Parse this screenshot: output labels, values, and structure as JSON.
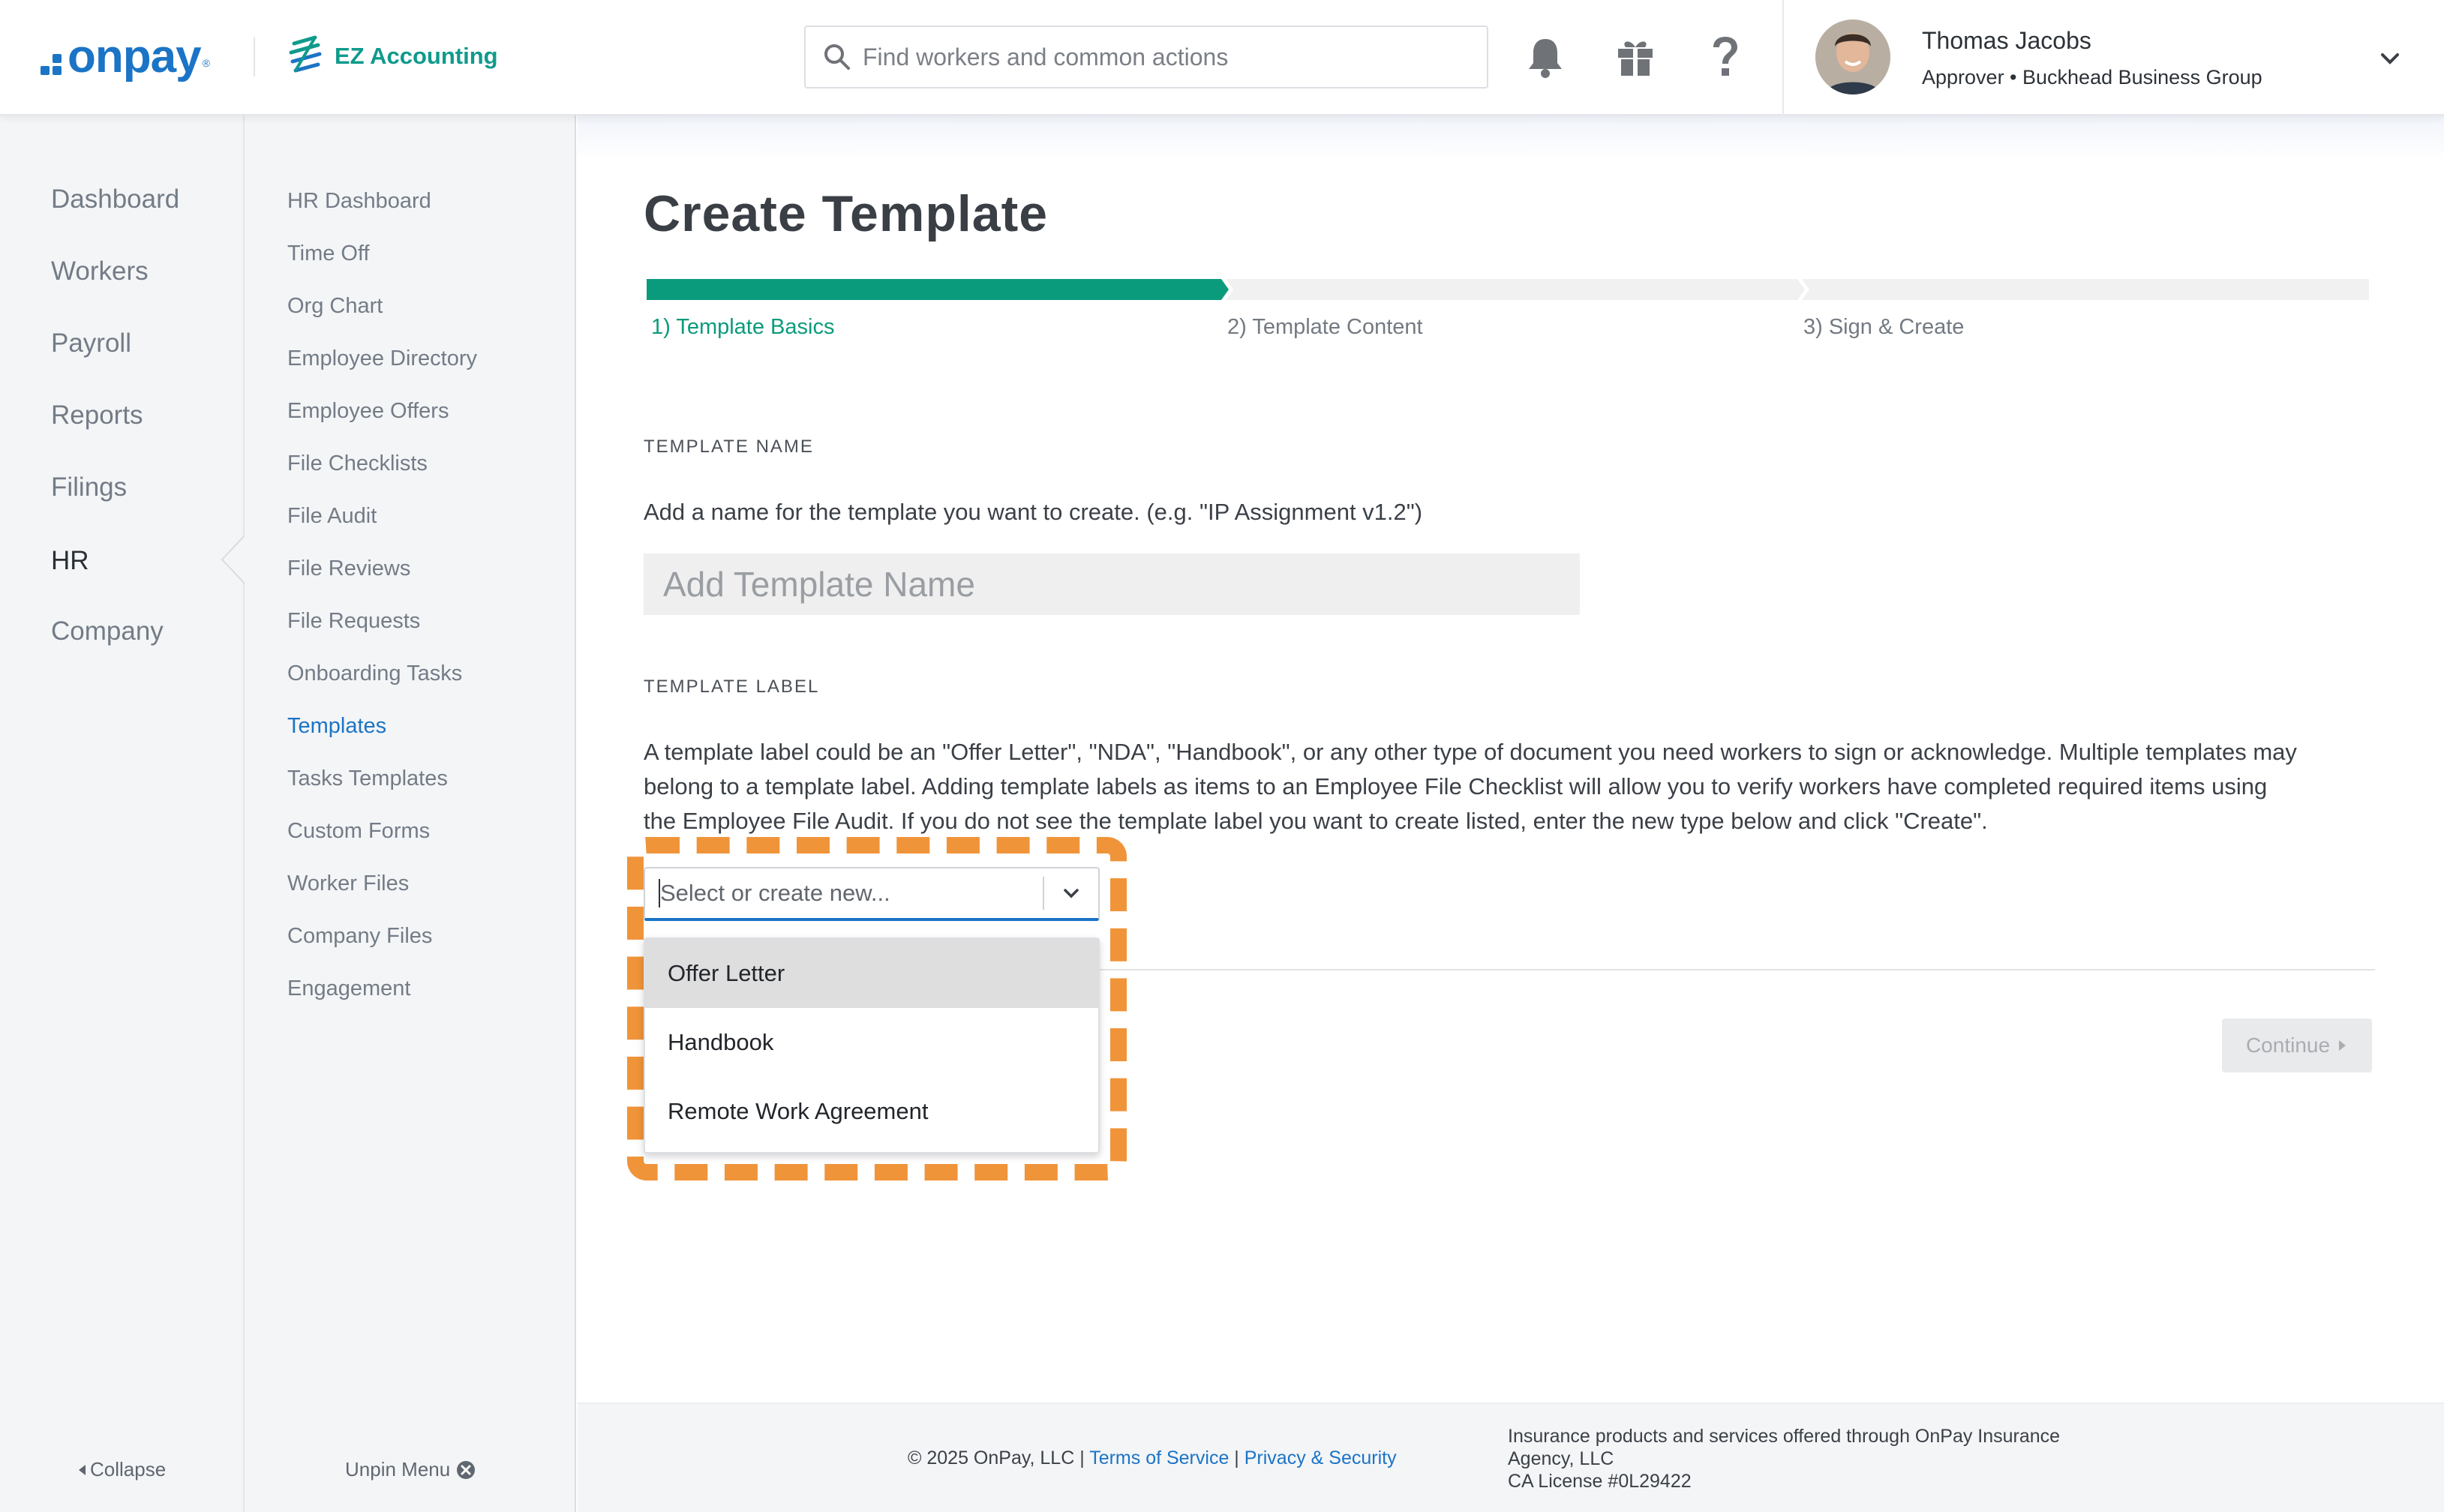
{
  "header": {
    "logo_onpay": "onpay",
    "logo_reg": "®",
    "logo_partner": "EZ Accounting",
    "search_placeholder": "Find workers and common actions",
    "user": {
      "name": "Thomas Jacobs",
      "role": "Approver • Buckhead Business Group"
    },
    "icons": [
      "bell-icon",
      "gift-icon",
      "help-icon",
      "chevron-down-icon"
    ]
  },
  "primary_nav": {
    "items": [
      "Dashboard",
      "Workers",
      "Payroll",
      "Reports",
      "Filings",
      "HR",
      "Company"
    ],
    "active": "HR",
    "collapse_label": "Collapse"
  },
  "secondary_nav": {
    "items": [
      "HR Dashboard",
      "Time Off",
      "Org Chart",
      "Employee Directory",
      "Employee Offers",
      "File Checklists",
      "File Audit",
      "File Reviews",
      "File Requests",
      "Onboarding Tasks",
      "Templates",
      "Tasks Templates",
      "Custom Forms",
      "Worker Files",
      "Company Files",
      "Engagement"
    ],
    "active": "Templates",
    "unpin_label": "Unpin Menu"
  },
  "main": {
    "title": "Create Template",
    "steps": [
      {
        "label": "1) Template Basics",
        "active": true
      },
      {
        "label": "2) Template Content",
        "active": false
      },
      {
        "label": "3) Sign & Create",
        "active": false
      }
    ],
    "template_name": {
      "heading": "TEMPLATE NAME",
      "help": "Add a name for the template you want to create. (e.g. \"IP Assignment v1.2\")",
      "placeholder": "Add Template Name",
      "value": ""
    },
    "template_label": {
      "heading": "TEMPLATE LABEL",
      "help_line1": "A template label could be an \"Offer Letter\", \"NDA\", \"Handbook\", or any other type of document you need workers to sign or acknowledge. Multiple templates may",
      "help_line2": "belong to a template label. Adding template labels as items to an Employee File Checklist will allow you to verify workers have completed required items using",
      "help_line3": "the Employee File Audit. If you do not see the template label you want to create listed, enter the new type below and click \"Create\".",
      "select_placeholder": "Select or create new...",
      "options": [
        "Offer Letter",
        "Handbook",
        "Remote Work Agreement"
      ],
      "highlighted_option": "Offer Letter"
    },
    "continue_label": "Continue"
  },
  "footer": {
    "copyright": "© 2025 OnPay, LLC | ",
    "terms": "Terms of Service",
    "sep": " | ",
    "privacy": "Privacy & Security",
    "insurance_line1": "Insurance products and services offered through OnPay Insurance",
    "insurance_line2": "Agency, LLC",
    "insurance_line3": "CA License #0L29422"
  },
  "colors": {
    "brand_blue": "#1b74c5",
    "accent_green": "#0f9a8c",
    "highlight_orange": "#f0943a"
  }
}
